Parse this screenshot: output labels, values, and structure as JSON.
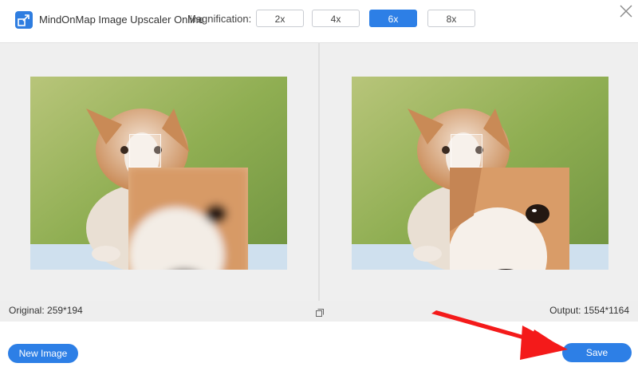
{
  "header": {
    "app_title": "MindOnMap Image Upscaler Online",
    "magnification_label": "Magnification:",
    "magnification_options": [
      "2x",
      "4x",
      "6x",
      "8x"
    ],
    "selected_magnification": "6x"
  },
  "footer": {
    "original_label": "Original: 259*194",
    "output_label": "Output: 1554*1164"
  },
  "actions": {
    "new_image_label": "New Image",
    "save_label": "Save"
  },
  "colors": {
    "accent": "#2d7fe6",
    "annotation_arrow": "#f41a1a"
  },
  "icons": [
    "app-logo-icon",
    "close-icon",
    "compare-icon",
    "annotation-arrow"
  ]
}
